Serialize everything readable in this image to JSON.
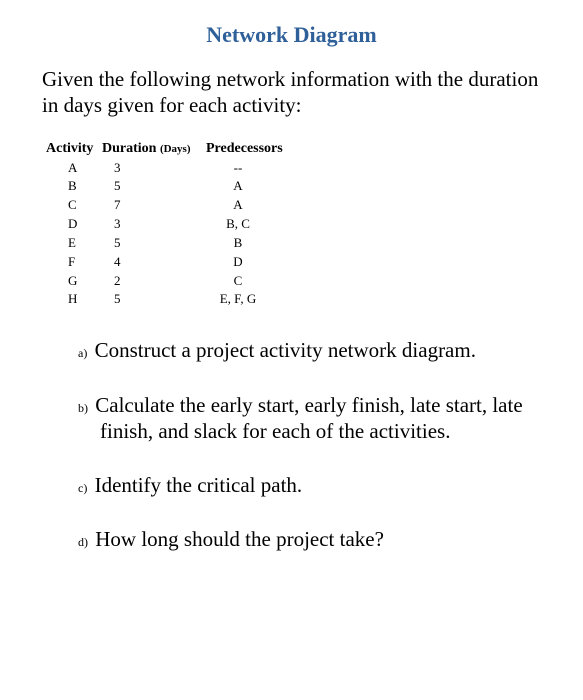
{
  "title": "Network Diagram",
  "intro": "Given the following network information with the duration in days given for each activity:",
  "table": {
    "headers": {
      "activity": "Activity",
      "duration": "Duration",
      "duration_unit": "(Days)",
      "predecessors": "Predecessors"
    },
    "rows": [
      {
        "activity": "A",
        "duration": "3",
        "predecessors": "--"
      },
      {
        "activity": "B",
        "duration": "5",
        "predecessors": "A"
      },
      {
        "activity": "C",
        "duration": "7",
        "predecessors": "A"
      },
      {
        "activity": "D",
        "duration": "3",
        "predecessors": "B, C"
      },
      {
        "activity": "E",
        "duration": "5",
        "predecessors": "B"
      },
      {
        "activity": "F",
        "duration": "4",
        "predecessors": "D"
      },
      {
        "activity": "G",
        "duration": "2",
        "predecessors": "C"
      },
      {
        "activity": "H",
        "duration": "5",
        "predecessors": "E, F, G"
      }
    ]
  },
  "questions": [
    {
      "label": "a)",
      "text": "Construct a project activity network diagram."
    },
    {
      "label": "b)",
      "text": "Calculate the early start, early finish, late start, late finish, and slack for each of the activities."
    },
    {
      "label": "c)",
      "text": "Identify the critical path."
    },
    {
      "label": "d)",
      "text": "How long should the project take?"
    }
  ],
  "chart_data": {
    "type": "table",
    "columns": [
      "Activity",
      "Duration (Days)",
      "Predecessors"
    ],
    "rows": [
      [
        "A",
        3,
        "--"
      ],
      [
        "B",
        5,
        "A"
      ],
      [
        "C",
        7,
        "A"
      ],
      [
        "D",
        3,
        "B, C"
      ],
      [
        "E",
        5,
        "B"
      ],
      [
        "F",
        4,
        "D"
      ],
      [
        "G",
        2,
        "C"
      ],
      [
        "H",
        5,
        "E, F, G"
      ]
    ]
  }
}
